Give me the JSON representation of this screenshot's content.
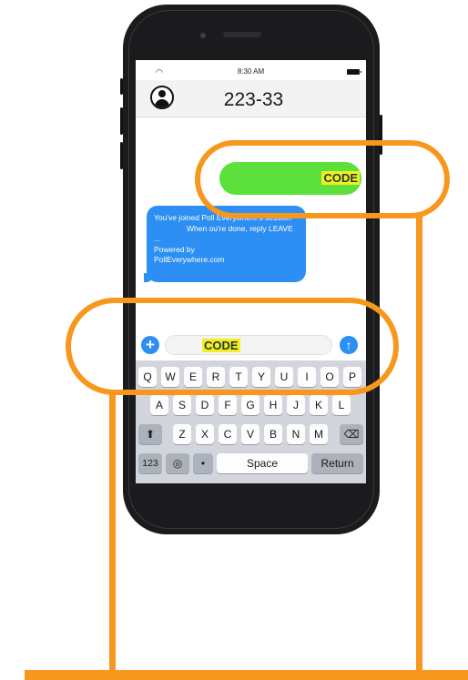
{
  "status_bar": {
    "time": "8:30 AM"
  },
  "header": {
    "contact": "223-33"
  },
  "messages": {
    "outgoing": {
      "text": "CODE"
    },
    "incoming": {
      "lines": [
        "You've joined Poll Everywhere's session",
        "When ou're done, reply LEAVE",
        "...",
        "Powered by",
        "PollEverywhere.com"
      ]
    }
  },
  "composer": {
    "value": "CODE"
  },
  "keyboard": {
    "row1": [
      "Q",
      "W",
      "E",
      "R",
      "T",
      "Y",
      "U",
      "I",
      "O",
      "P"
    ],
    "row2": [
      "A",
      "S",
      "D",
      "F",
      "G",
      "H",
      "J",
      "K",
      "L"
    ],
    "row3": [
      "Z",
      "X",
      "C",
      "V",
      "B",
      "N",
      "M"
    ],
    "numbers_label": "123",
    "space_label": "Space",
    "return_label": "Return"
  },
  "icons": {
    "plus": "plus-icon",
    "send": "arrow-up-icon",
    "shift": "shift-icon",
    "backspace": "backspace-icon",
    "globe": "globe-icon",
    "mic": "microphone-icon"
  },
  "colors": {
    "annotation": "#f7971d",
    "highlight": "#f6ee1c",
    "outgoing_bubble": "#5ce03c",
    "incoming_bubble": "#2d8ff4"
  }
}
